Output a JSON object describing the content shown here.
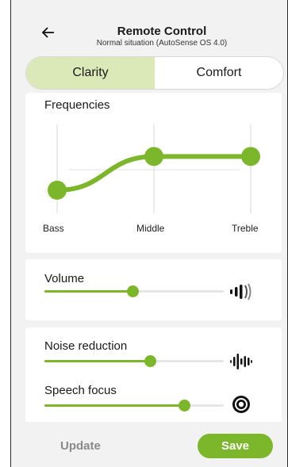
{
  "header": {
    "title": "Remote Control",
    "subtitle": "Normal situation (AutoSense OS 4.0)",
    "back_icon": "arrow-left-icon"
  },
  "tabs": [
    {
      "label": "Clarity",
      "active": true
    },
    {
      "label": "Comfort",
      "active": false
    }
  ],
  "frequencies": {
    "title": "Frequencies",
    "bands": [
      {
        "label": "Bass",
        "level": 0.26
      },
      {
        "label": "Middle",
        "level": 0.64
      },
      {
        "label": "Treble",
        "level": 0.64
      }
    ]
  },
  "volume": {
    "label": "Volume",
    "value": 0.49,
    "icon": "volume-sound-icon"
  },
  "noise_reduction": {
    "label": "Noise reduction",
    "value": 0.59,
    "icon": "noise-waveform-icon"
  },
  "speech_focus": {
    "label": "Speech focus",
    "value": 0.78,
    "icon": "speech-focus-target-icon"
  },
  "footer": {
    "update_label": "Update",
    "save_label": "Save"
  },
  "colors": {
    "accent": "#7cb62b",
    "active_tab": "#dbe8b8",
    "background": "#f2f2f2"
  }
}
